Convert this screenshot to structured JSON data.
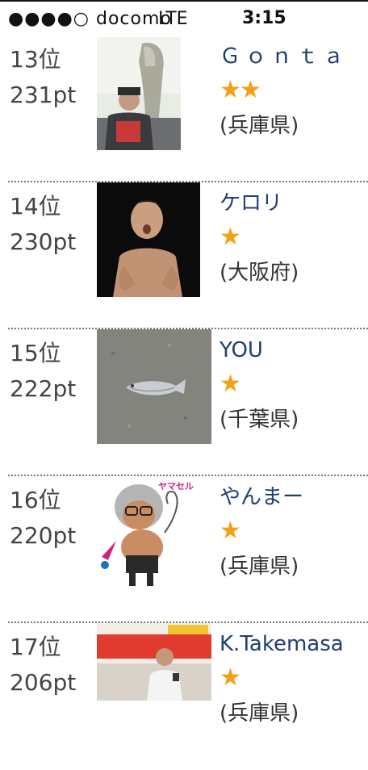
{
  "status_bar": {
    "signal": "●●●●○",
    "carrier": "docomo",
    "network": "LTE",
    "time": "3:15"
  },
  "ranking": [
    {
      "rank": "13位",
      "points": "231pt",
      "name": "Ｇｏｎｔａ",
      "stars": "★★",
      "prefecture": "(兵庫県)",
      "thumb_icon": "angler-fish-photo"
    },
    {
      "rank": "14位",
      "points": "230pt",
      "name": "ケロリ",
      "stars": "★",
      "prefecture": "(大阪府)",
      "thumb_icon": "fighter-photo"
    },
    {
      "rank": "15位",
      "points": "222pt",
      "name": "YOU",
      "stars": "★",
      "prefecture": "(千葉県)",
      "thumb_icon": "fish-on-ground-photo"
    },
    {
      "rank": "16位",
      "points": "220pt",
      "name": "やんまー",
      "stars": "★",
      "prefecture": "(兵庫県)",
      "thumb_icon": "cartoon-character-image"
    },
    {
      "rank": "17位",
      "points": "206pt",
      "name": "K.Takemasa",
      "stars": "★",
      "prefecture": "(兵庫県)",
      "thumb_icon": "event-speaker-photo"
    }
  ],
  "colors": {
    "name_link": "#1f3f70",
    "star": "#f3a015",
    "divider": "#777777"
  }
}
